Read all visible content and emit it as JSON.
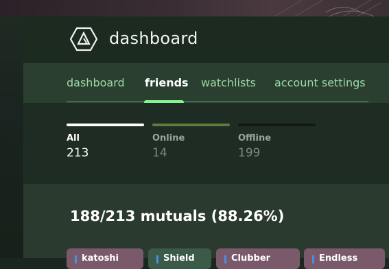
{
  "app": {
    "title": "dashboard"
  },
  "tabs": [
    {
      "label": "dashboard",
      "active": false
    },
    {
      "label": "friends",
      "active": true
    },
    {
      "label": "watchlists",
      "active": false
    },
    {
      "label": "account settings",
      "active": false
    }
  ],
  "counts": [
    {
      "label": "All",
      "value": "213",
      "active": true
    },
    {
      "label": "Online",
      "value": "14",
      "active": false
    },
    {
      "label": "Offline",
      "value": "199",
      "active": false
    }
  ],
  "mutuals": {
    "text": "188/213 mutuals (88.26%)"
  },
  "chips": [
    {
      "label": "katoshi"
    },
    {
      "label": "Shield"
    },
    {
      "label": "Clubber"
    },
    {
      "label": "Endless"
    }
  ],
  "colors": {
    "accent": "#86f58f",
    "tab_inactive": "#9ed8a6",
    "online_bar": "#5f7a3c",
    "offline_bar": "#1a1d19"
  }
}
